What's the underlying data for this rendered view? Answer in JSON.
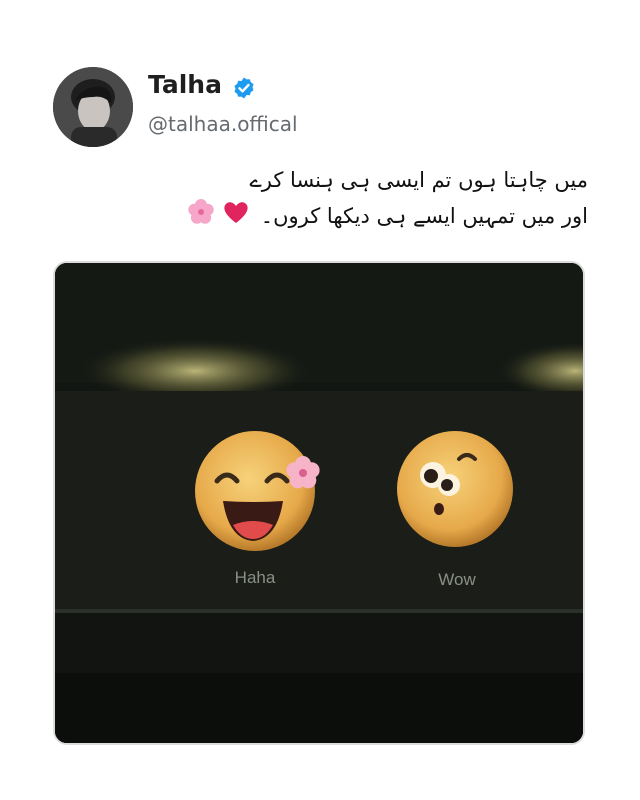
{
  "author": {
    "name": "Talha",
    "handle": "@talhaa.offical",
    "verified": true,
    "avatar_icon": "profile-photo"
  },
  "tweet": {
    "line1": "میں چاہتا ہوں تم ایسی ہی ہنسا کرے",
    "line2": "اور میں تمہیں ایسے ہی دیکھا کروں۔"
  },
  "media": {
    "reactions": [
      {
        "label": "Haha",
        "icon": "laughing-face-icon"
      },
      {
        "label": "Wow",
        "icon": "surprised-face-icon"
      }
    ]
  },
  "colors": {
    "verified_badge": "#1d9bf0",
    "heart": "#e0245e",
    "blossom": "#f6a6c8"
  }
}
